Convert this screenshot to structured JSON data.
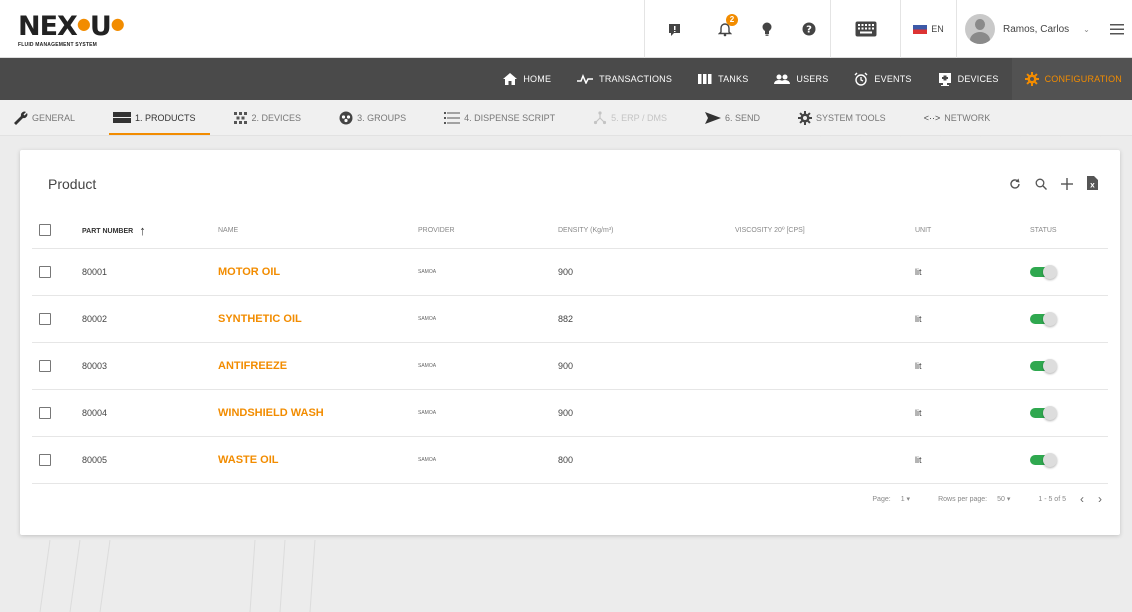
{
  "brand": {
    "logo": "NEX·U",
    "subtitle": "FLUID MANAGEMENT SYSTEM"
  },
  "topbar": {
    "notification_count": "2",
    "language": "EN",
    "user_name": "Ramos, Carlos"
  },
  "main_nav": [
    {
      "label": "HOME",
      "icon": "home-icon"
    },
    {
      "label": "TRANSACTIONS",
      "icon": "pulse-icon"
    },
    {
      "label": "TANKS",
      "icon": "tanks-icon"
    },
    {
      "label": "USERS",
      "icon": "users-icon"
    },
    {
      "label": "EVENTS",
      "icon": "alarm-clock-icon"
    },
    {
      "label": "DEVICES",
      "icon": "device-icon"
    },
    {
      "label": "CONFIGURATION",
      "icon": "gear-icon",
      "active": true
    }
  ],
  "sub_nav": [
    {
      "label": "GENERAL",
      "icon": "wrench-icon"
    },
    {
      "label": "1. PRODUCTS",
      "icon": "products-icon",
      "active": true
    },
    {
      "label": "2. DEVICES",
      "icon": "devices-grid-icon"
    },
    {
      "label": "3. GROUPS",
      "icon": "groups-icon"
    },
    {
      "label": "4. DISPENSE SCRIPT",
      "icon": "list-icon"
    },
    {
      "label": "5. ERP / DMS",
      "icon": "erp-icon",
      "disabled": true
    },
    {
      "label": "6. SEND",
      "icon": "send-icon"
    },
    {
      "label": "SYSTEM TOOLS",
      "icon": "tools-gear-icon"
    },
    {
      "label": "NETWORK",
      "icon": "network-icon"
    }
  ],
  "card": {
    "title": "Product",
    "columns": {
      "part_number": "PART NUMBER",
      "name": "NAME",
      "provider": "PROVIDER",
      "density": "DENSITY (Kg/m³)",
      "viscosity": "VISCOSITY 20º [cPs]",
      "unit": "UNIT",
      "status": "STATUS"
    },
    "rows": [
      {
        "part_number": "80001",
        "name": "MOTOR OIL",
        "provider": "SAMOA",
        "density": "900",
        "viscosity": "",
        "unit": "lit",
        "status": true
      },
      {
        "part_number": "80002",
        "name": "SYNTHETIC OIL",
        "provider": "SAMOA",
        "density": "882",
        "viscosity": "",
        "unit": "lit",
        "status": true
      },
      {
        "part_number": "80003",
        "name": "ANTIFREEZE",
        "provider": "SAMOA",
        "density": "900",
        "viscosity": "",
        "unit": "lit",
        "status": true
      },
      {
        "part_number": "80004",
        "name": "WINDSHIELD WASH",
        "provider": "SAMOA",
        "density": "900",
        "viscosity": "",
        "unit": "lit",
        "status": true
      },
      {
        "part_number": "80005",
        "name": "WASTE OIL",
        "provider": "SAMOA",
        "density": "800",
        "viscosity": "",
        "unit": "lit",
        "status": true
      }
    ],
    "pager": {
      "page_label": "Page:",
      "page_value": "1",
      "rows_label": "Rows per page:",
      "rows_value": "50",
      "range": "1 - 5 of 5"
    }
  },
  "colors": {
    "accent": "#f28c00",
    "toggle_on": "#2fa84f",
    "nav_bg": "#4a4a4a"
  }
}
